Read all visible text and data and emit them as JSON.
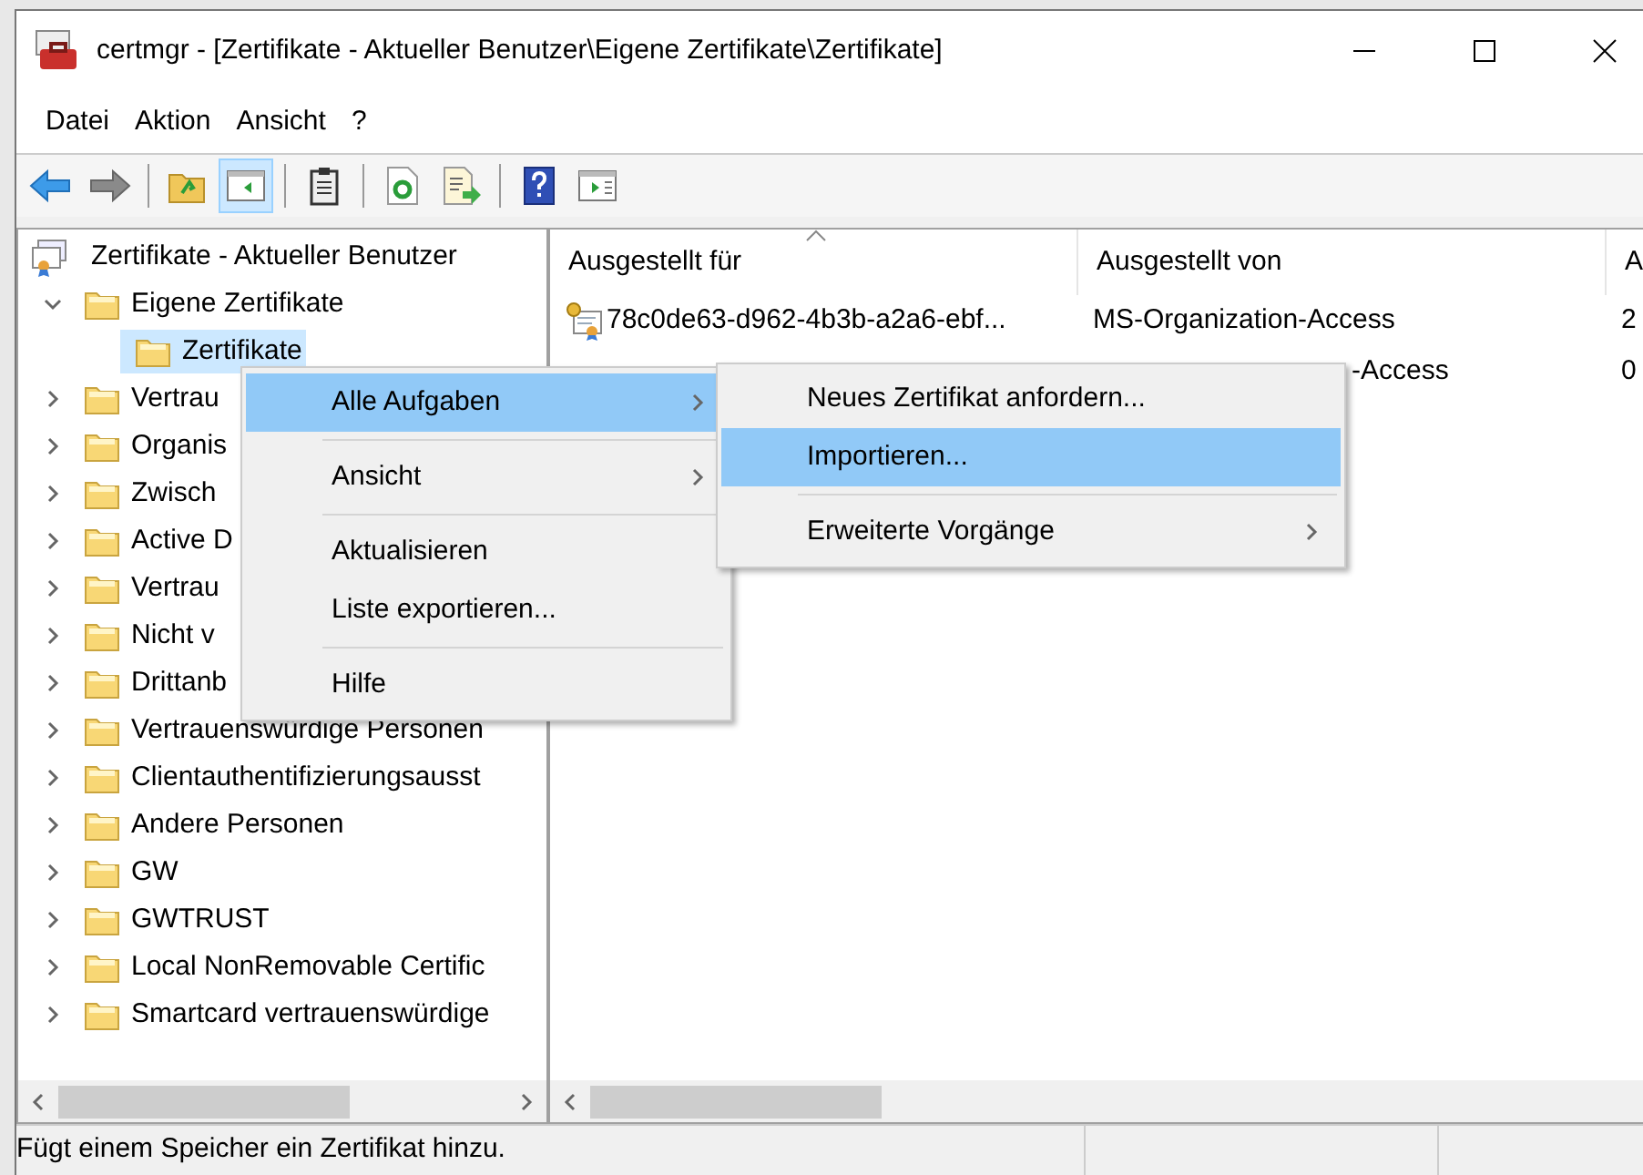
{
  "window": {
    "title": "certmgr - [Zertifikate - Aktueller Benutzer\\Eigene Zertifikate\\Zertifikate]"
  },
  "menu_bar": [
    "Datei",
    "Aktion",
    "Ansicht",
    "?"
  ],
  "toolbar": [
    {
      "kind": "back",
      "pressed": false
    },
    {
      "kind": "forward",
      "pressed": false
    },
    {
      "kind": "separator"
    },
    {
      "kind": "folder-up",
      "pressed": false
    },
    {
      "kind": "tree-pane",
      "pressed": true
    },
    {
      "kind": "separator"
    },
    {
      "kind": "clipboard",
      "pressed": false
    },
    {
      "kind": "separator"
    },
    {
      "kind": "refresh",
      "pressed": false
    },
    {
      "kind": "export",
      "pressed": false
    },
    {
      "kind": "separator"
    },
    {
      "kind": "help",
      "pressed": false
    },
    {
      "kind": "action-pane",
      "pressed": false
    }
  ],
  "tree": {
    "label": "Zertifikate - Aktueller Benutzer",
    "children": [
      {
        "label": "Eigene Zertifikate",
        "expanded": true,
        "selected": false,
        "children": [
          {
            "label": "Zertifikate",
            "selected": true
          }
        ]
      },
      {
        "label": "Vertrau",
        "expanded": false,
        "selected": false
      },
      {
        "label": "Organis",
        "expanded": false,
        "selected": false
      },
      {
        "label": "Zwisch",
        "expanded": false,
        "selected": false
      },
      {
        "label": "Active D",
        "expanded": false,
        "selected": false
      },
      {
        "label": "Vertrau",
        "expanded": false,
        "selected": false
      },
      {
        "label": "Nicht v",
        "expanded": false,
        "selected": false
      },
      {
        "label": "Drittanb",
        "expanded": false,
        "selected": false
      },
      {
        "label": "Vertrauenswürdige Personen",
        "expanded": false,
        "selected": false
      },
      {
        "label": "Clientauthentifizierungsausst",
        "expanded": false,
        "selected": false
      },
      {
        "label": "Andere Personen",
        "expanded": false,
        "selected": false
      },
      {
        "label": "GW",
        "expanded": false,
        "selected": false
      },
      {
        "label": "GWTRUST",
        "expanded": false,
        "selected": false
      },
      {
        "label": "Local NonRemovable Certific",
        "expanded": false,
        "selected": false
      },
      {
        "label": "Smartcard vertrauenswürdige",
        "expanded": false,
        "selected": false
      }
    ]
  },
  "table": {
    "columns": [
      "Ausgestellt für",
      "Ausgestellt von",
      "A"
    ],
    "rows": [
      {
        "cells": [
          "78c0de63-d962-4b3b-a2a6-ebf...",
          "MS-Organization-Access",
          "2"
        ],
        "icon": true
      },
      {
        "cells": [
          "",
          "-Access",
          "0"
        ],
        "icon": false
      }
    ]
  },
  "context_menu": [
    {
      "kind": "item",
      "label": "Alle Aufgaben",
      "submenu": true,
      "selected": true
    },
    {
      "kind": "separator"
    },
    {
      "kind": "item",
      "label": "Ansicht",
      "submenu": true,
      "selected": false
    },
    {
      "kind": "separator"
    },
    {
      "kind": "item",
      "label": "Aktualisieren",
      "submenu": false,
      "selected": false
    },
    {
      "kind": "item",
      "label": "Liste exportieren...",
      "submenu": false,
      "selected": false
    },
    {
      "kind": "separator"
    },
    {
      "kind": "item",
      "label": "Hilfe",
      "submenu": false,
      "selected": false
    }
  ],
  "submenu": [
    {
      "kind": "item",
      "label": "Neues Zertifikat anfordern...",
      "submenu": false,
      "selected": false
    },
    {
      "kind": "item",
      "label": "Importieren...",
      "submenu": false,
      "selected": true
    },
    {
      "kind": "separator"
    },
    {
      "kind": "item",
      "label": "Erweiterte Vorgänge",
      "submenu": true,
      "selected": false
    }
  ],
  "status_bar": {
    "text": "Fügt einem Speicher ein Zertifikat hinzu."
  }
}
